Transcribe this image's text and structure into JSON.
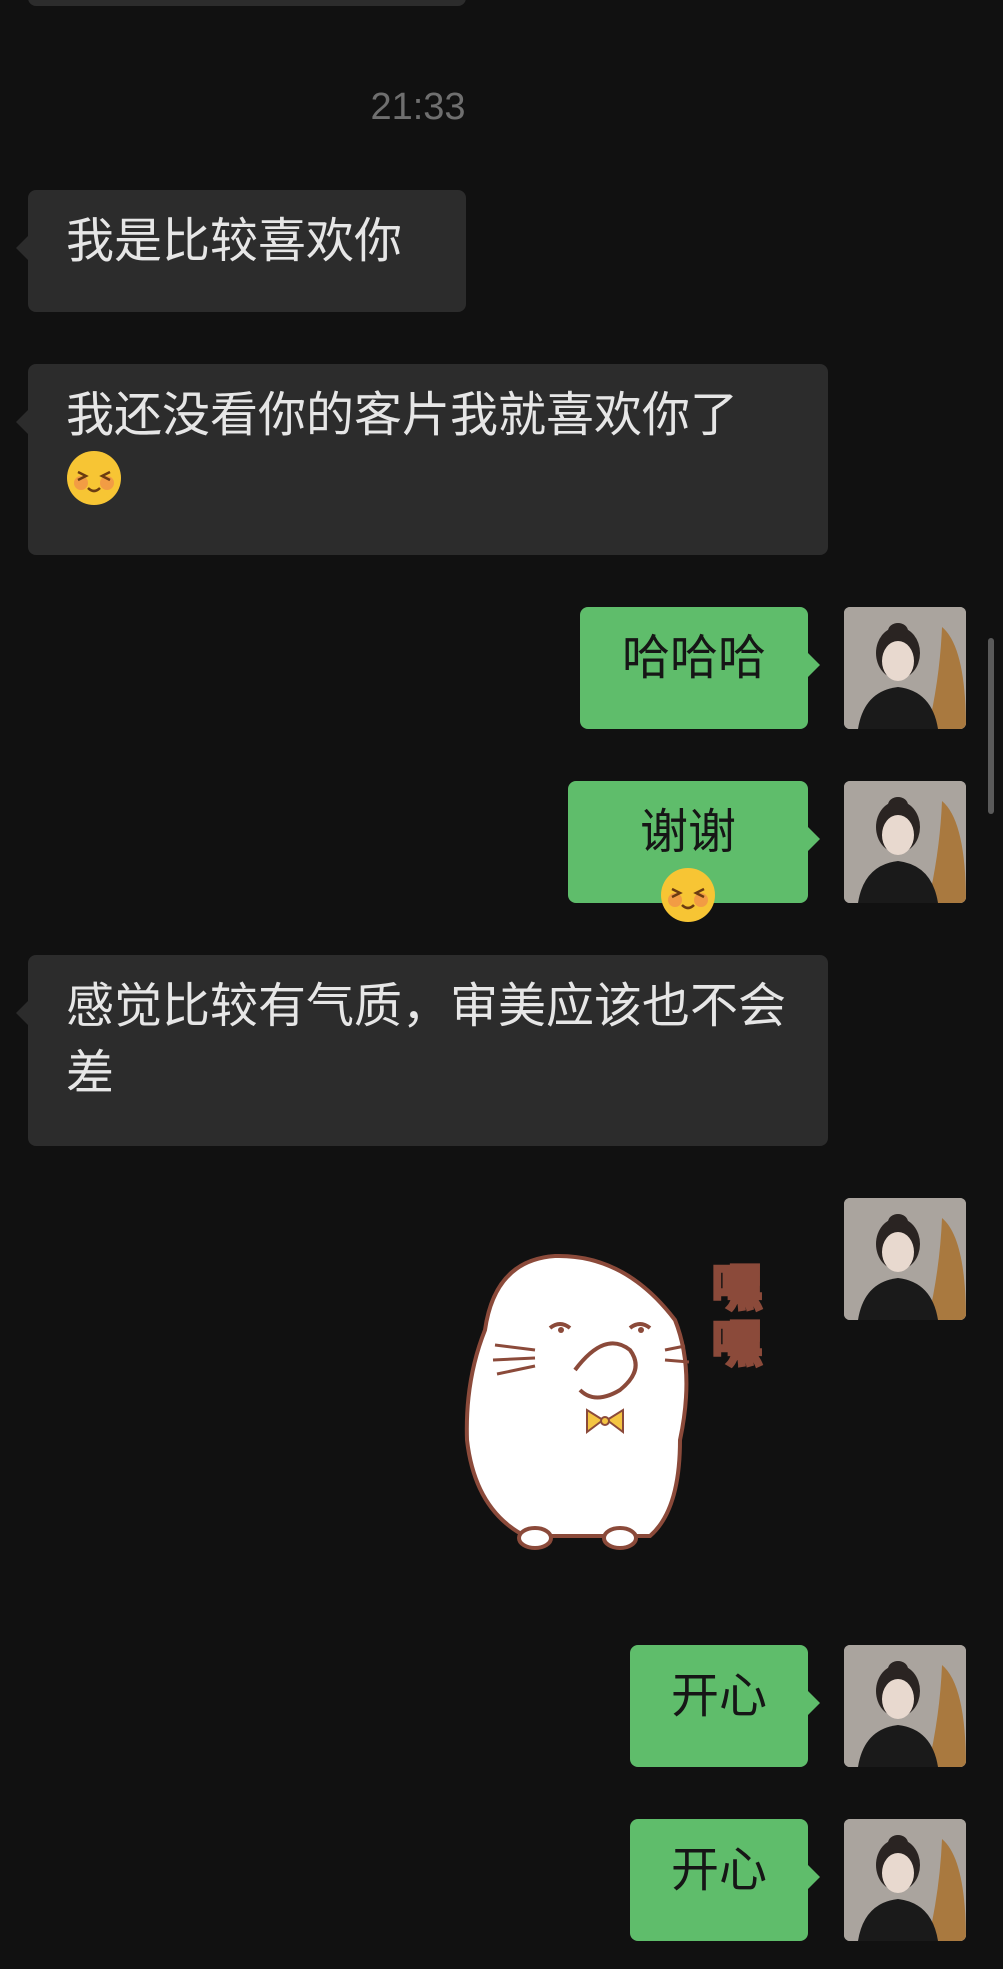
{
  "chat": {
    "timestamp": "21:33",
    "messages": [
      {
        "side": "left",
        "text": "我是比较喜欢你"
      },
      {
        "side": "left",
        "text": "我还没看你的客片我就喜欢你了",
        "emoji": "blushing-smile-emoji"
      },
      {
        "side": "right",
        "text": "哈哈哈"
      },
      {
        "side": "right",
        "text": "谢谢",
        "emoji": "blushing-smile-emoji"
      },
      {
        "side": "left",
        "text": "感觉比较有气质，审美应该也不会差"
      },
      {
        "side": "right",
        "type": "sticker",
        "sticker_text": "嘿嘿",
        "sticker": "seal-giggling-sticker"
      },
      {
        "side": "right",
        "text": "开心"
      },
      {
        "side": "right",
        "text": "开心"
      }
    ]
  },
  "colors": {
    "background": "#111111",
    "incoming_bubble": "#2c2c2c",
    "outgoing_bubble": "#5fbd6b",
    "timestamp": "#6f6f6f"
  }
}
